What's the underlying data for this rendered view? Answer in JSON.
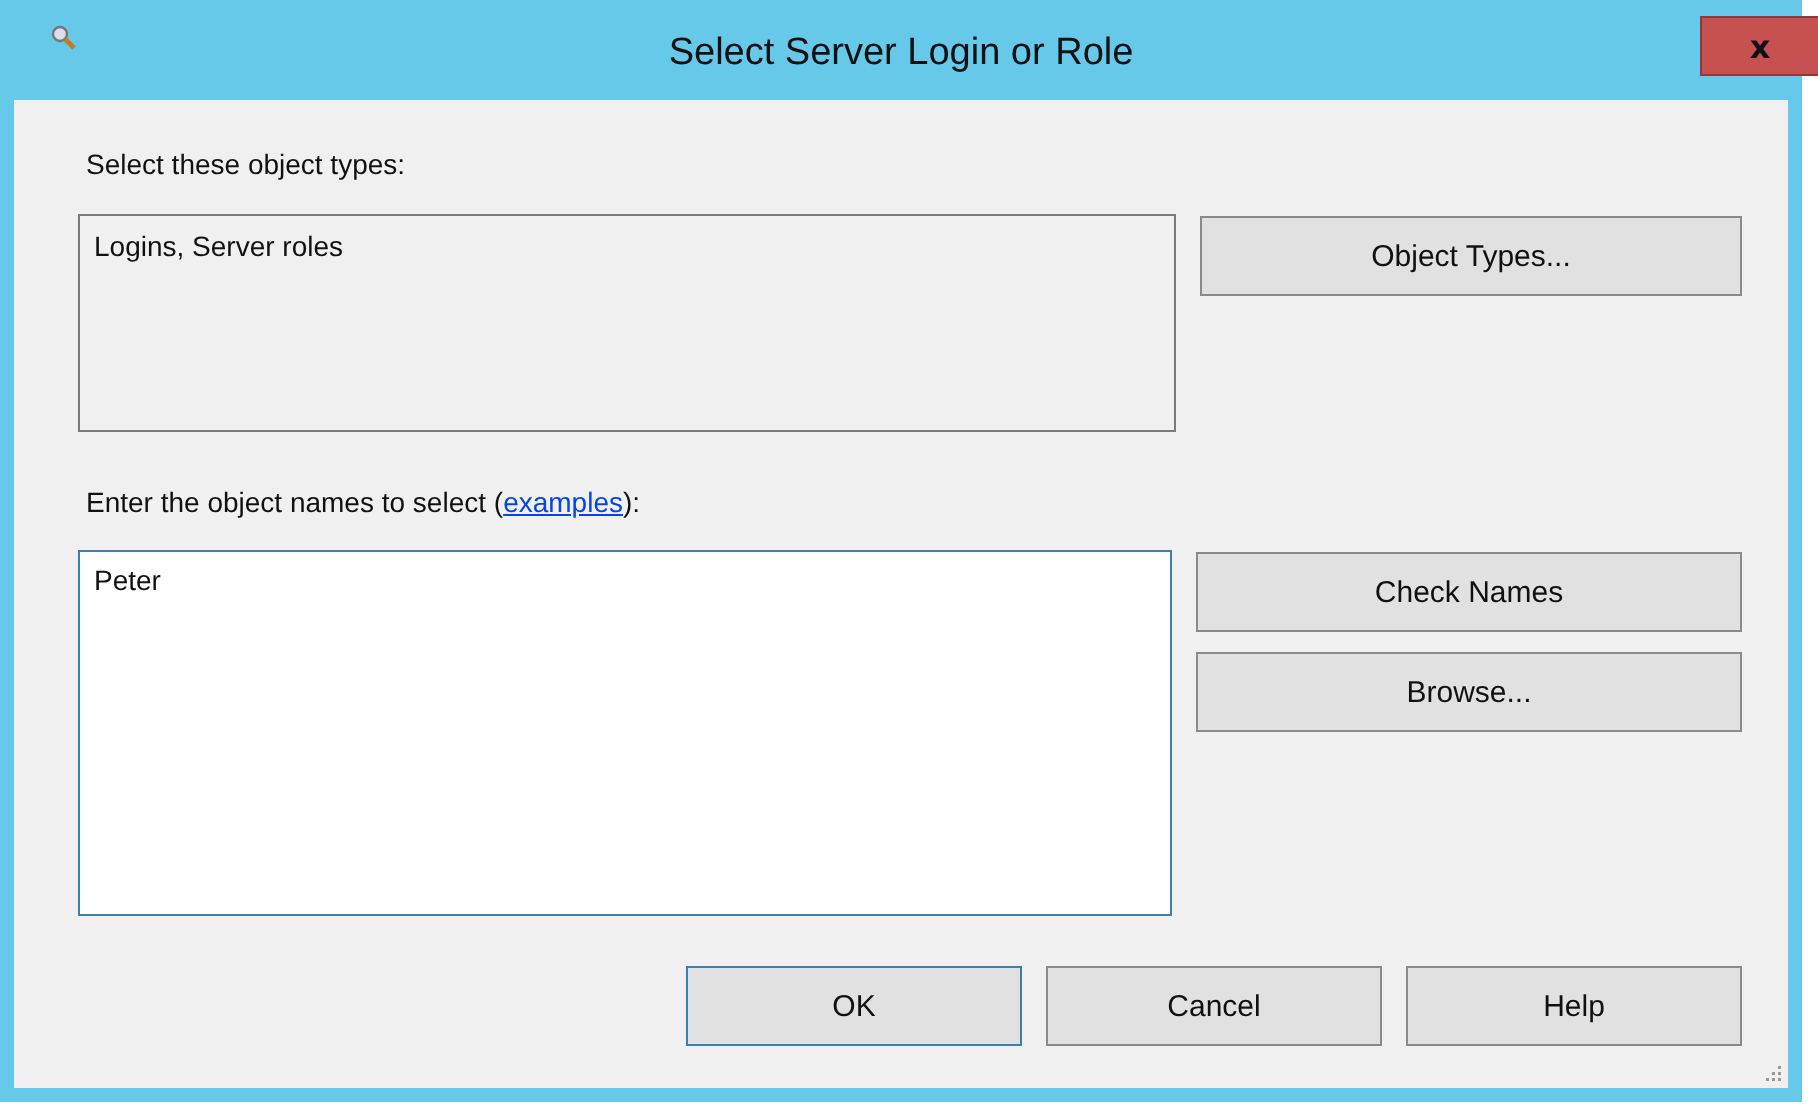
{
  "window": {
    "title": "Select Server Login or Role",
    "close": "x"
  },
  "object_types": {
    "label": "Select these object types:",
    "value": "Logins, Server roles",
    "button": "Object Types..."
  },
  "object_names": {
    "label_before": "Enter the object names to select (",
    "link": "examples",
    "label_after": "):",
    "value": "Peter",
    "focused": true
  },
  "side_buttons": [
    "Check Names",
    "Browse..."
  ],
  "buttons": [
    {
      "label": "OK",
      "default": true
    },
    {
      "label": "Cancel",
      "default": false
    },
    {
      "label": "Help",
      "default": false
    }
  ]
}
